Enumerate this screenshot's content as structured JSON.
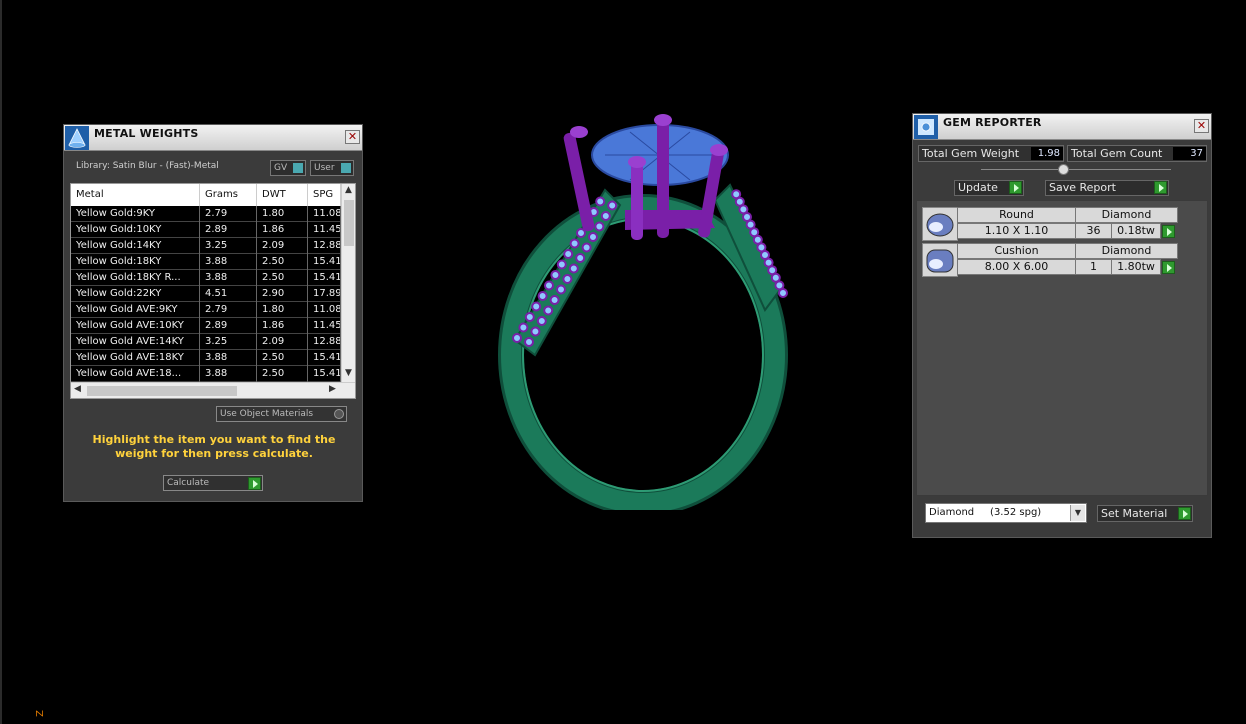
{
  "metal_weights": {
    "title": "METAL WEIGHTS",
    "library": "Library: Satin Blur - (Fast)-Metal",
    "toggle_gv": "GV",
    "toggle_user": "User",
    "columns": [
      "Metal",
      "Grams",
      "DWT",
      "SPG"
    ],
    "rows": [
      [
        "Yellow Gold:9KY",
        "2.79",
        "1.80",
        "11.08"
      ],
      [
        "Yellow Gold:10KY",
        "2.89",
        "1.86",
        "11.45"
      ],
      [
        "Yellow Gold:14KY",
        "3.25",
        "2.09",
        "12.88"
      ],
      [
        "Yellow Gold:18KY",
        "3.88",
        "2.50",
        "15.41"
      ],
      [
        "Yellow Gold:18KY R...",
        "3.88",
        "2.50",
        "15.41"
      ],
      [
        "Yellow Gold:22KY",
        "4.51",
        "2.90",
        "17.89"
      ],
      [
        "Yellow Gold AVE:9KY",
        "2.79",
        "1.80",
        "11.08"
      ],
      [
        "Yellow Gold AVE:10KY",
        "2.89",
        "1.86",
        "11.45"
      ],
      [
        "Yellow Gold AVE:14KY",
        "3.25",
        "2.09",
        "12.88"
      ],
      [
        "Yellow Gold AVE:18KY",
        "3.88",
        "2.50",
        "15.41"
      ],
      [
        "Yellow Gold AVE:18...",
        "3.88",
        "2.50",
        "15.41"
      ]
    ],
    "use_object_materials": "Use Object Materials",
    "hint": "Highlight the item you want to find the weight for then press calculate.",
    "calculate": "Calculate"
  },
  "gem_reporter": {
    "title": "GEM REPORTER",
    "total_weight_label": "Total Gem Weight",
    "total_weight_value": "1.98",
    "total_count_label": "Total Gem Count",
    "total_count_value": "37",
    "update": "Update",
    "save_report": "Save Report",
    "gems": [
      {
        "shape": "Round",
        "type": "Diamond",
        "size": "1.10 X 1.10",
        "count": "36",
        "weight": "0.18tw"
      },
      {
        "shape": "Cushion",
        "type": "Diamond",
        "size": "8.00 X 6.00",
        "count": "1",
        "weight": "1.80tw"
      }
    ],
    "material_select": "Diamond     (3.52 spg)",
    "set_material": "Set Material"
  },
  "viewport": {
    "axis_label": "Z",
    "colors": {
      "band": "#1b7a5a",
      "prongs": "#7a1fa8",
      "stone": "#4a78d8",
      "accent_stones": "#8fc8ff"
    }
  }
}
